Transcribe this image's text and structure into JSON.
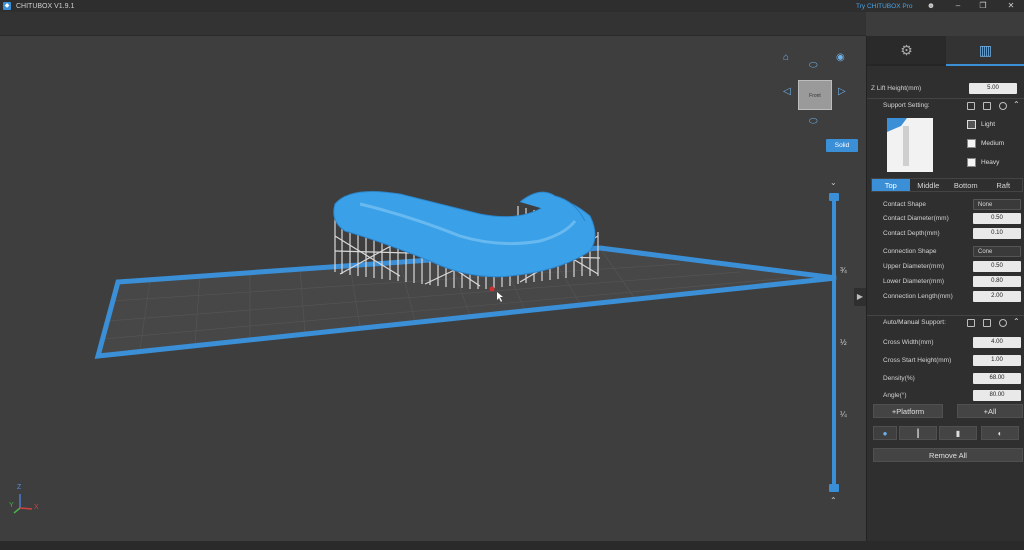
{
  "app": {
    "title": "CHITUBOX V1.9.1",
    "try_link": "Try CHITUBOX Pro",
    "icons": [
      "user-icon",
      "minimize-icon",
      "restore-icon",
      "close-icon"
    ]
  },
  "viewport": {
    "viewcube_label": "Front",
    "solid_label": "Solid",
    "slider_labels": [
      "¾",
      "½",
      "¼"
    ],
    "axis": {
      "z": "Z",
      "y": "Y",
      "x": "X"
    },
    "colors": {
      "model": "#3aa0e8",
      "plate_border": "#3a8fd6",
      "support": "#d8d8d8",
      "background": "#3e3e3e"
    }
  },
  "panel": {
    "tabs": [
      {
        "name": "settings-tab",
        "icon": "gear-icon"
      },
      {
        "name": "support-tab",
        "icon": "support-icon"
      }
    ],
    "z_lift_label": "Z Lift Height(mm)",
    "z_lift_value": "5.00",
    "support_setting_label": "Support Setting:",
    "density": {
      "light": {
        "label": "Light",
        "checked": true
      },
      "medium": {
        "label": "Medium",
        "checked": false
      },
      "heavy": {
        "label": "Heavy",
        "checked": false
      }
    },
    "segments": [
      "Top",
      "Middle",
      "Bottom",
      "Raft"
    ],
    "active_segment": "Top",
    "top_fields": {
      "contact_shape": {
        "label": "Contact Shape",
        "value": "None"
      },
      "contact_diameter": {
        "label": "Contact Diameter(mm)",
        "value": "0.50"
      },
      "contact_depth": {
        "label": "Contact Depth(mm)",
        "value": "0.10"
      },
      "connection_shape": {
        "label": "Connection Shape",
        "value": "Cone"
      },
      "upper_diameter": {
        "label": "Upper Diameter(mm)",
        "value": "0.50"
      },
      "lower_diameter": {
        "label": "Lower Diameter(mm)",
        "value": "0.80"
      },
      "connection_length": {
        "label": "Connection Length(mm)",
        "value": "2.00"
      }
    },
    "auto_manual_label": "Auto/Manual Support:",
    "auto_fields": {
      "cross_width": {
        "label": "Cross Width(mm)",
        "value": "4.00"
      },
      "cross_start": {
        "label": "Cross Start Height(mm)",
        "value": "1.00"
      },
      "density": {
        "label": "Density(%)",
        "value": "68.00"
      },
      "angle": {
        "label": "Angle(°)",
        "value": "80.00"
      }
    },
    "platform_button": "+Platform",
    "all_button": "+All",
    "remove_all_button": "Remove All"
  }
}
